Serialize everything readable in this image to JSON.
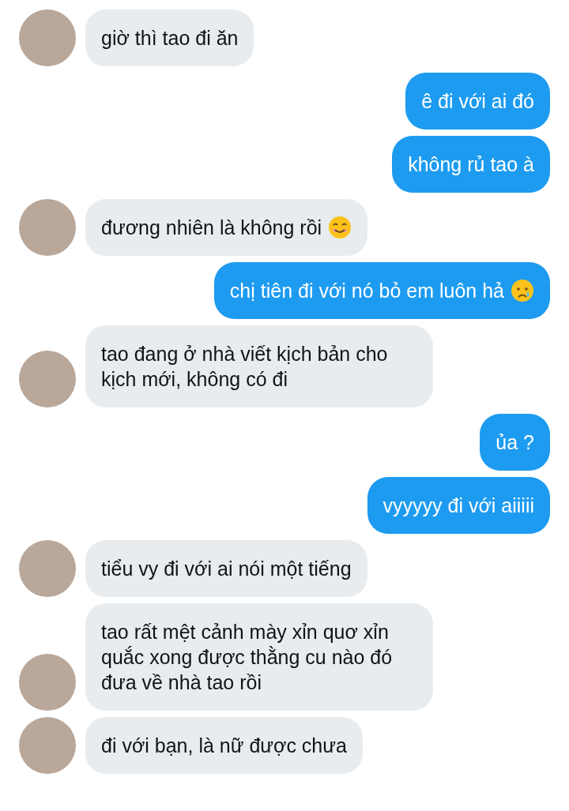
{
  "messages": [
    {
      "kind": "received",
      "text": "giờ thì tao đi ăn"
    },
    {
      "kind": "sent",
      "text": "ê đi với ai đó"
    },
    {
      "kind": "sent",
      "text": "không rủ tao à"
    },
    {
      "kind": "received",
      "text": "đương nhiên là không rồi",
      "emoji": {
        "kind": "smile"
      }
    },
    {
      "kind": "sent",
      "text": "chị tiên đi với nó bỏ em luôn hả",
      "emoji": {
        "kind": "cry"
      }
    },
    {
      "kind": "received",
      "text": "tao đang ở nhà viết kịch bản cho kịch mới, không có đi"
    },
    {
      "kind": "sent",
      "text": "ủa ?"
    },
    {
      "kind": "sent",
      "text": "vyyyyy đi với aiiiii"
    },
    {
      "kind": "received",
      "text": "tiểu vy đi với ai nói một tiếng"
    },
    {
      "kind": "received",
      "text": "tao rất mệt cảnh mày xỉn quơ xỉn quắc xong được thằng cu nào đó đưa về nhà tao rồi"
    },
    {
      "kind": "received",
      "text": "đi với bạn, là nữ được chưa"
    }
  ]
}
